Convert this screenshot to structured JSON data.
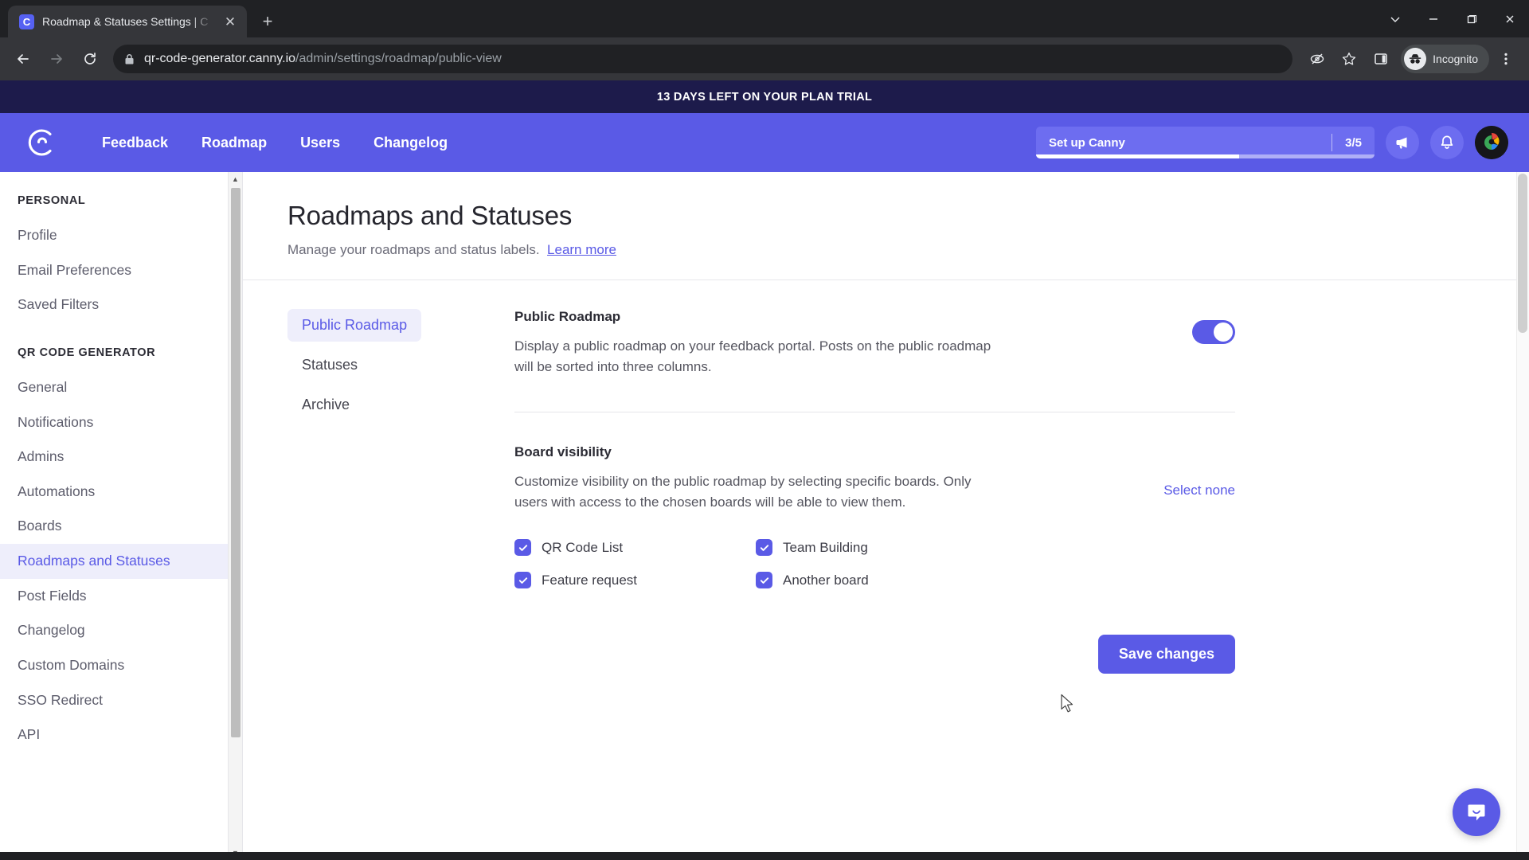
{
  "browser": {
    "tab": {
      "title": "Roadmap & Statuses Settings | C",
      "favicon_icon": "canny-logo-icon",
      "close_icon": "close-icon"
    },
    "new_tab_icon": "plus-icon",
    "window_controls": [
      {
        "name": "chevron-down-icon",
        "glyph": "v"
      },
      {
        "name": "minimize-icon",
        "glyph": "-"
      },
      {
        "name": "maximize-icon",
        "glyph": "□"
      },
      {
        "name": "close-window-icon",
        "glyph": "x"
      }
    ],
    "nav": {
      "back_icon": "back-arrow-icon",
      "forward_icon": "forward-arrow-icon",
      "reload_icon": "reload-icon"
    },
    "omnibox": {
      "lock_icon": "lock-icon",
      "url_domain": "qr-code-generator.canny.io",
      "url_path": "/admin/settings/roadmap/public-view"
    },
    "toolbar_icons": [
      {
        "name": "tracking-protection-icon"
      },
      {
        "name": "bookmark-star-icon"
      },
      {
        "name": "side-panel-icon"
      }
    ],
    "incognito": {
      "label": "Incognito",
      "icon": "incognito-icon"
    },
    "menu_icon": "three-dot-menu-icon"
  },
  "trial_banner": {
    "text": "13 DAYS LEFT ON YOUR PLAN TRIAL",
    "bg": "#1d1b4b"
  },
  "app_header": {
    "logo_icon": "canny-logo-icon",
    "bg": "#5a5ae6",
    "nav": [
      {
        "label": "Feedback"
      },
      {
        "label": "Roadmap"
      },
      {
        "label": "Users"
      },
      {
        "label": "Changelog"
      }
    ],
    "setup": {
      "label": "Set up Canny",
      "count": "3/5",
      "progress_percent": 60
    },
    "announce_icon": "megaphone-icon",
    "notifications_icon": "bell-icon",
    "avatar_icon": "user-avatar"
  },
  "sidebar": {
    "groups": [
      {
        "title": "PERSONAL",
        "items": [
          {
            "label": "Profile",
            "active": false
          },
          {
            "label": "Email Preferences",
            "active": false
          },
          {
            "label": "Saved Filters",
            "active": false
          }
        ]
      },
      {
        "title": "QR CODE GENERATOR",
        "items": [
          {
            "label": "General",
            "active": false
          },
          {
            "label": "Notifications",
            "active": false
          },
          {
            "label": "Admins",
            "active": false
          },
          {
            "label": "Automations",
            "active": false
          },
          {
            "label": "Boards",
            "active": false
          },
          {
            "label": "Roadmaps and Statuses",
            "active": true
          },
          {
            "label": "Post Fields",
            "active": false
          },
          {
            "label": "Changelog",
            "active": false
          },
          {
            "label": "Custom Domains",
            "active": false
          },
          {
            "label": "SSO Redirect",
            "active": false
          },
          {
            "label": "API",
            "active": false
          }
        ]
      }
    ],
    "scroll_up_icon": "scroll-up-arrow-icon",
    "scroll_down_icon": "scroll-down-arrow-icon"
  },
  "main": {
    "title": "Roadmaps and Statuses",
    "subtitle": "Manage your roadmaps and status labels.",
    "learn_more": "Learn more",
    "tabs": [
      {
        "label": "Public Roadmap",
        "active": true
      },
      {
        "label": "Statuses",
        "active": false
      },
      {
        "label": "Archive",
        "active": false
      }
    ],
    "public_roadmap": {
      "heading": "Public Roadmap",
      "description": "Display a public roadmap on your feedback portal. Posts on the public roadmap will be sorted into three columns.",
      "toggle_on": true
    },
    "board_visibility": {
      "heading": "Board visibility",
      "description": "Customize visibility on the public roadmap by selecting specific boards. Only users with access to the chosen boards will be able to view them.",
      "select_none": "Select none",
      "boards": [
        {
          "label": "QR Code List",
          "checked": true
        },
        {
          "label": "Team Building",
          "checked": true
        },
        {
          "label": "Feature request",
          "checked": true
        },
        {
          "label": "Another board",
          "checked": true
        }
      ]
    },
    "save_label": "Save changes"
  },
  "intercom": {
    "icon": "chat-bubble-icon"
  },
  "colors": {
    "accent": "#5a5ae6",
    "accent_soft": "#eeeefb",
    "banner": "#1d1b4b"
  }
}
